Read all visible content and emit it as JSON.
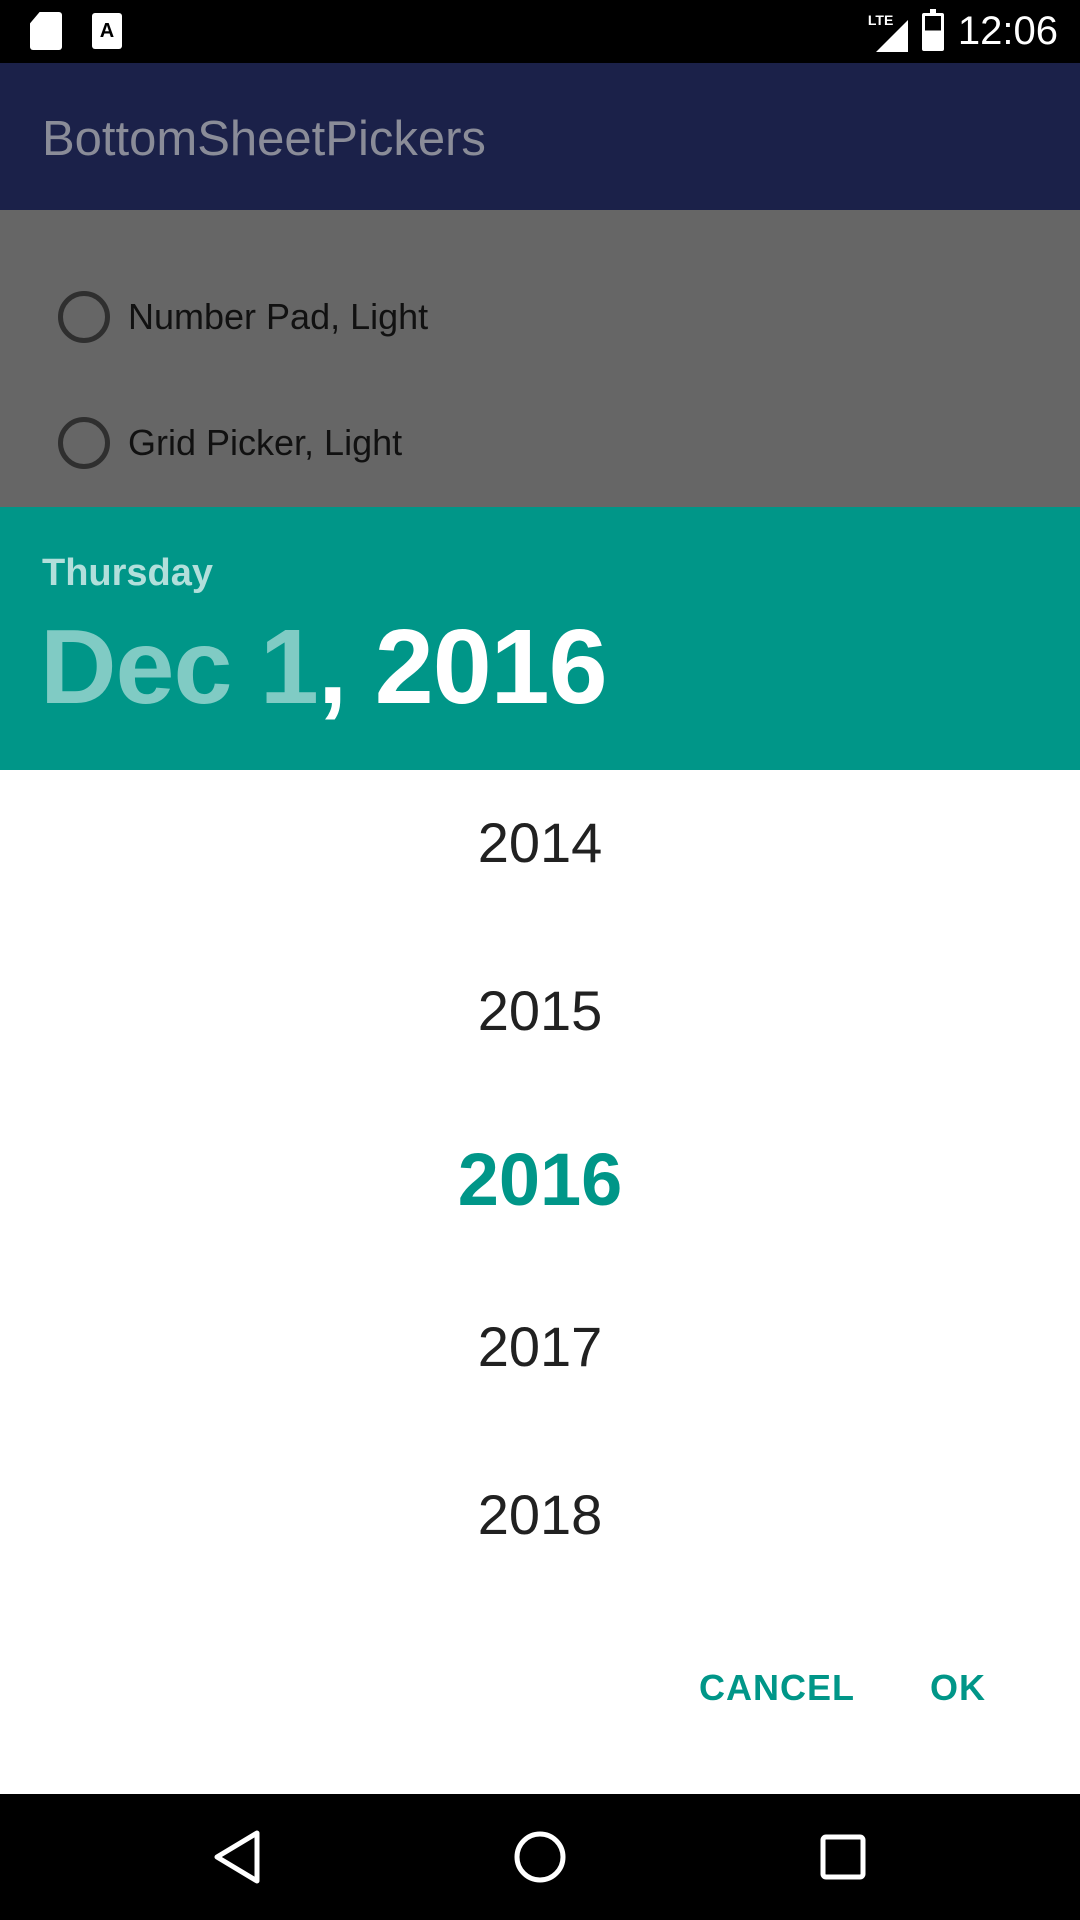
{
  "status_bar": {
    "time": "12:06",
    "network_label": "LTE",
    "icons": [
      "sd-card-icon",
      "a-text-icon",
      "lte-signal-icon",
      "battery-charging-icon"
    ]
  },
  "app_bar": {
    "title": "BottomSheetPickers"
  },
  "options": [
    {
      "label": "Number Pad, Light"
    },
    {
      "label": "Grid Picker, Light"
    }
  ],
  "picker": {
    "day_of_week": "Thursday",
    "month_day": "Dec 1",
    "separator": ",",
    "year": "2016",
    "years": [
      "2014",
      "2015",
      "2016",
      "2017",
      "2018"
    ],
    "selected_year": "2016",
    "cancel_label": "CANCEL",
    "ok_label": "OK"
  },
  "colors": {
    "accent": "#009688",
    "header_dim_text": "#80cbc4",
    "app_bar_dimmed": "#1b2149",
    "scrim_content": "#666666"
  },
  "nav_bar": {
    "icons": [
      "back-icon",
      "home-icon",
      "recents-icon"
    ]
  }
}
